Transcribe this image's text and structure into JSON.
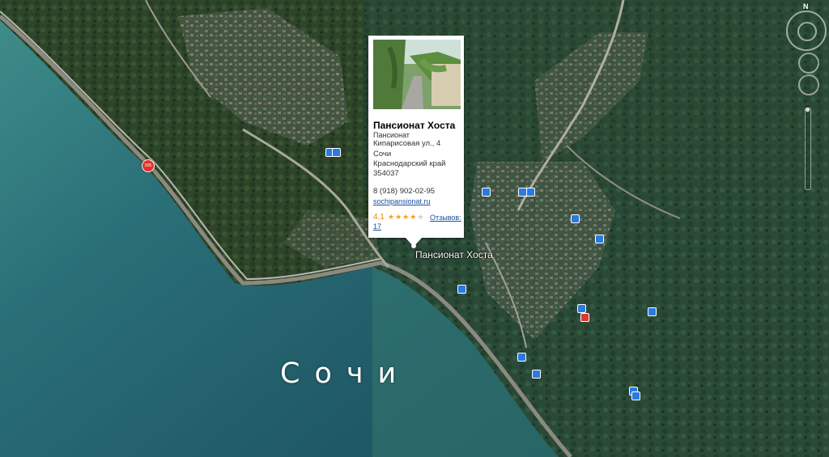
{
  "map": {
    "city_label": "Сочи",
    "place_label": "Пансионат Хоста",
    "red_marker_text": "505",
    "compass_label": "N"
  },
  "popup": {
    "title": "Пансионат Хоста",
    "title_suffix": "-",
    "category": "Пансионат",
    "street": "Кипарисовая ул., 4",
    "city": "Сочи",
    "region": "Краснодарский край",
    "postcode": "354037",
    "phone": "8 (918) 902-02-95",
    "website": "sochipansionat.ru",
    "rating": "4.1",
    "stars_filled": 4,
    "stars_total": 5,
    "reviews_label": "Отзывов:",
    "reviews_count": "17"
  },
  "colors": {
    "sea_deep": "#1e5d68",
    "sea_light": "#3a8a86",
    "forest": "#2f4a2c",
    "poi_blue": "#2a7ae0",
    "poi_red": "#d83a2e",
    "link": "#1a4fa0",
    "star": "#f2a022"
  }
}
